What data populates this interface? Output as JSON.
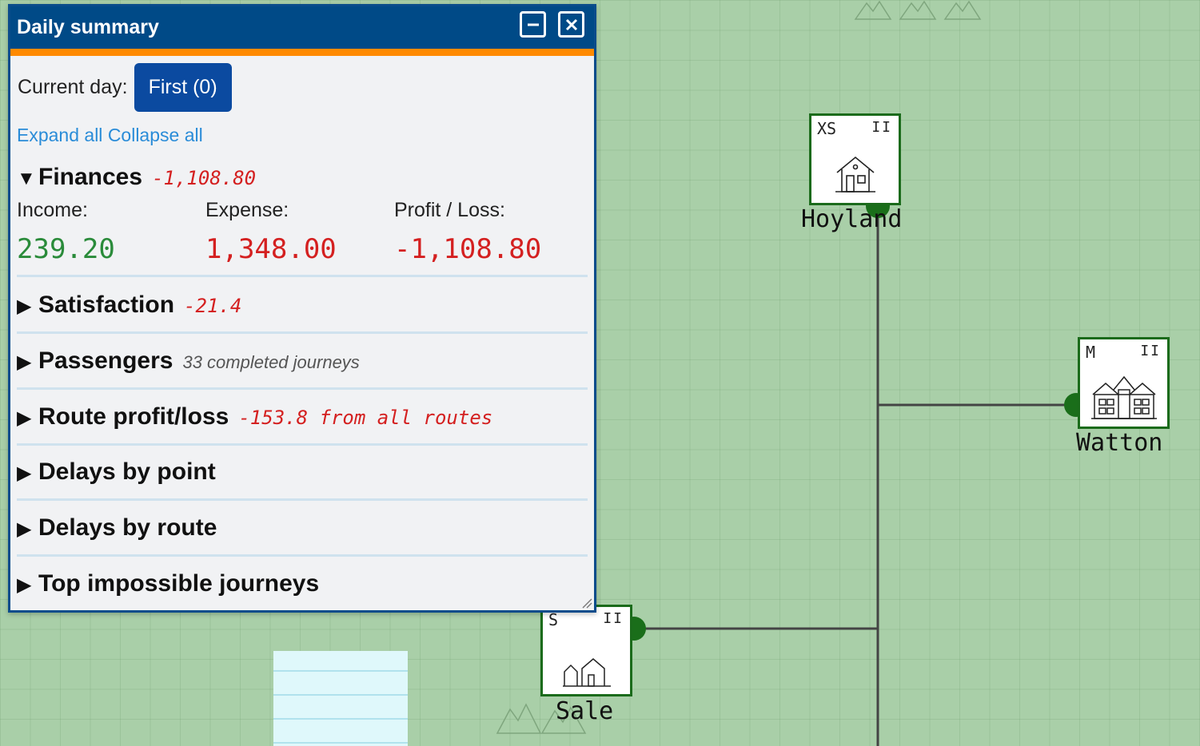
{
  "panel": {
    "title": "Daily summary",
    "current_day_label": "Current day:",
    "current_day_value": "First (0)",
    "expand_all": "Expand all",
    "collapse_all": "Collapse all",
    "finances": {
      "title": "Finances",
      "summary": "-1,108.80",
      "income_label": "Income:",
      "income_value": "239.20",
      "expense_label": "Expense:",
      "expense_value": "1,348.00",
      "profit_label": "Profit / Loss:",
      "profit_value": "-1,108.80"
    },
    "sections": [
      {
        "title": "Satisfaction",
        "summary": "-21.4"
      },
      {
        "title": "Passengers",
        "summary": "33 completed journeys"
      },
      {
        "title": "Route profit/loss",
        "summary": "-153.8 from all routes"
      },
      {
        "title": "Delays by point",
        "summary": ""
      },
      {
        "title": "Delays by route",
        "summary": ""
      },
      {
        "title": "Top impossible journeys",
        "summary": ""
      }
    ],
    "icons": [
      "minimize-icon",
      "close-icon",
      "resize-handle-icon",
      "triangle-down-icon",
      "triangle-right-icon"
    ]
  },
  "map": {
    "stations": [
      {
        "name": "Hoyland",
        "size": "XS",
        "pause": "II",
        "icon": "house-icon"
      },
      {
        "name": "Watton",
        "size": "M",
        "pause": "II",
        "icon": "town-hall-icon"
      },
      {
        "name": "Sale",
        "size": "S",
        "pause": "II",
        "icon": "village-icon"
      }
    ],
    "colors": {
      "grass": "#a9cfa8",
      "track": "#444444",
      "station_border": "#1b6b1b",
      "water": "#dff8fb"
    }
  }
}
